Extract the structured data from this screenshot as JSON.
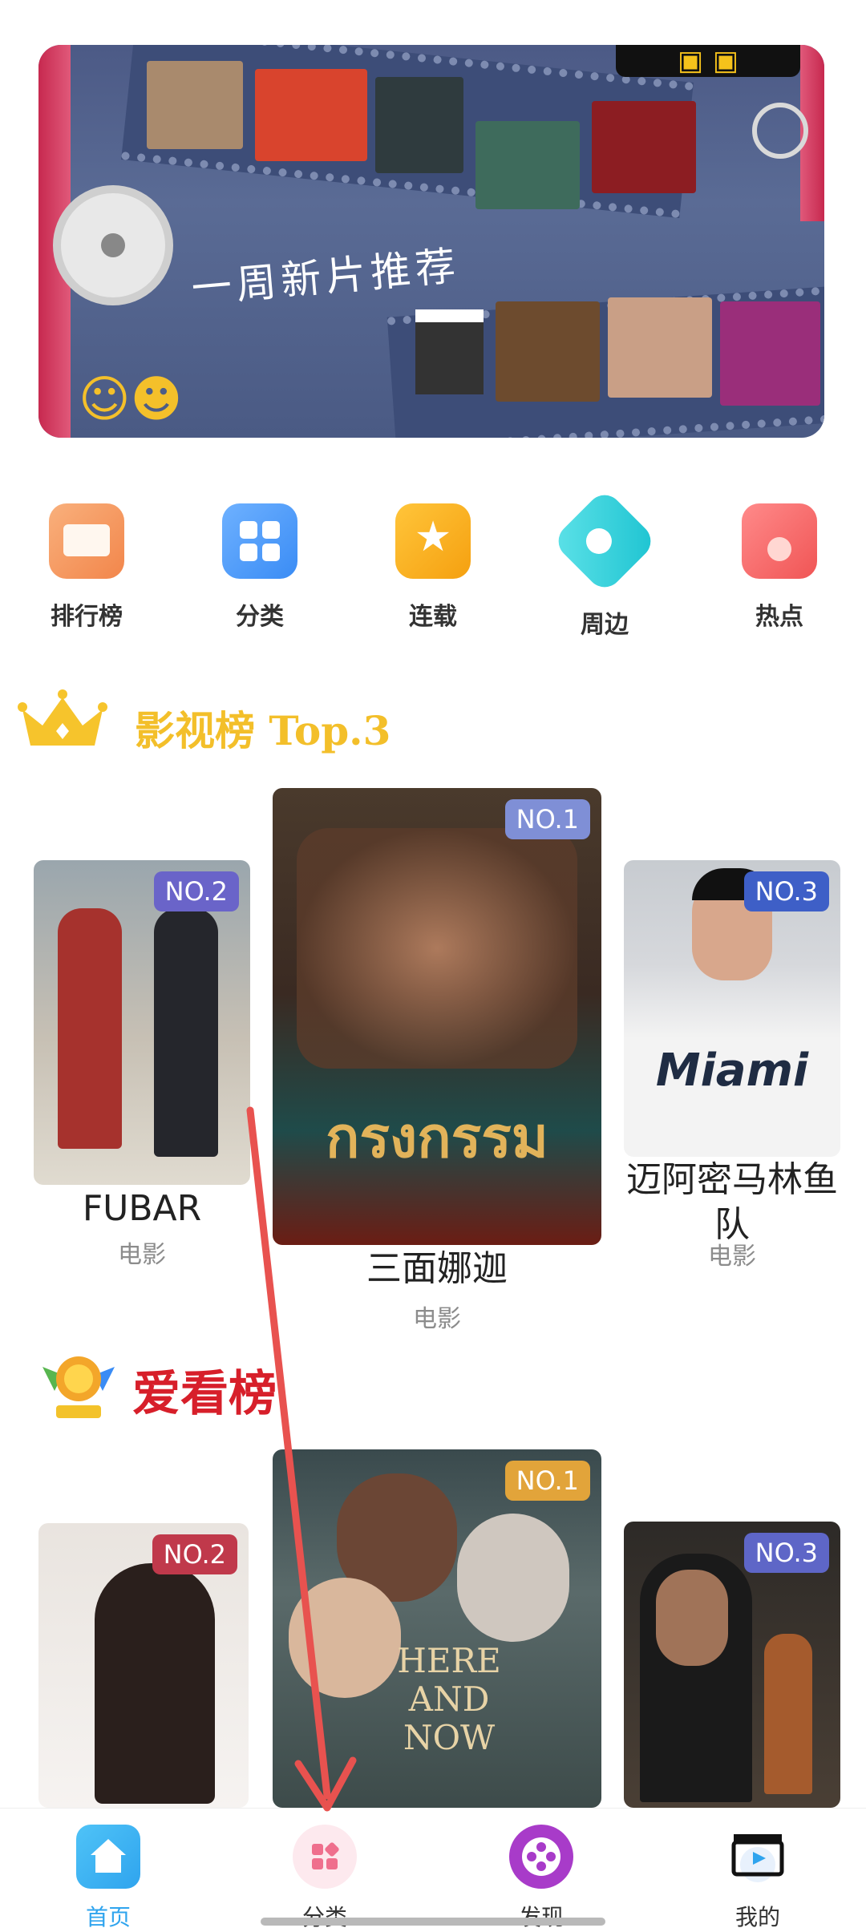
{
  "banner": {
    "title": "一周新片推荐"
  },
  "categories": [
    {
      "label": "排行榜",
      "icon": "book-icon"
    },
    {
      "label": "分类",
      "icon": "grid-icon"
    },
    {
      "label": "连载",
      "icon": "star-icon"
    },
    {
      "label": "周边",
      "icon": "location-pin-icon"
    },
    {
      "label": "热点",
      "icon": "flame-icon"
    }
  ],
  "section1": {
    "title": "影视榜 Top.3",
    "cards": [
      {
        "rank": "NO.2",
        "title": "FUBAR",
        "type": "电影"
      },
      {
        "rank": "NO.1",
        "title": "三面娜迦",
        "type": "电影",
        "poster_text": "กรงกรรม"
      },
      {
        "rank": "NO.3",
        "title": "迈阿密马林鱼队",
        "type": "电影",
        "poster_text": "Miami"
      }
    ]
  },
  "section2": {
    "title": "爱看榜",
    "cards": [
      {
        "rank": "NO.2"
      },
      {
        "rank": "NO.1",
        "poster_text": "HERE AND NOW"
      },
      {
        "rank": "NO.3"
      }
    ]
  },
  "bottom_nav": [
    {
      "label": "首页",
      "icon": "home-icon",
      "active": true
    },
    {
      "label": "分类",
      "icon": "category-icon"
    },
    {
      "label": "发现",
      "icon": "film-reel-icon"
    },
    {
      "label": "我的",
      "icon": "clapper-icon"
    }
  ],
  "colors": {
    "accent_blue": "#2fa4ee",
    "gold": "#f3bf2a",
    "red": "#d71f2a",
    "badge_purple": "#6a64c9",
    "badge_orange": "#e2a43a",
    "badge_red": "#c0394b",
    "badge_blue": "#3e5fc7"
  }
}
